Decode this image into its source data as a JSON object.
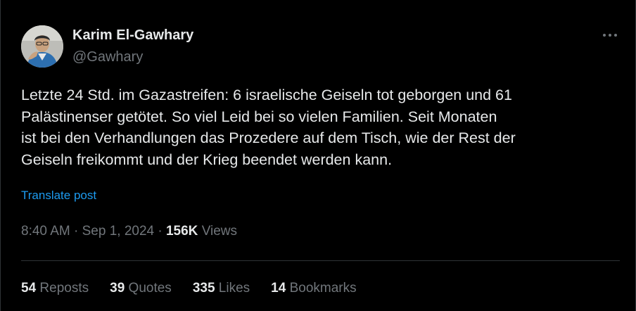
{
  "author": {
    "display_name": "Karim El-Gawhary",
    "handle": "@Gawhary"
  },
  "post": {
    "text": "Letzte 24 Std. im Gazastreifen: 6 israelische Geiseln tot geborgen und 61\nPalästinenser getötet. So viel  Leid bei so vielen Familien. Seit Monaten\nist bei den Verhandlungen das Prozedere auf dem Tisch, wie der Rest der\nGeiseln freikommt und der Krieg  beendet werden kann.",
    "translate_label": "Translate post"
  },
  "meta": {
    "time": "8:40 AM",
    "date": "Sep 1, 2024",
    "separator": "·",
    "views_count": "156K",
    "views_label": "Views"
  },
  "stats": {
    "reposts_count": "54",
    "reposts_label": "Reposts",
    "quotes_count": "39",
    "quotes_label": "Quotes",
    "likes_count": "335",
    "likes_label": "Likes",
    "bookmarks_count": "14",
    "bookmarks_label": "Bookmarks"
  },
  "icons": {
    "more": "more-horizontal-icon"
  },
  "colors": {
    "background": "#000000",
    "primary_text": "#e7e9ea",
    "secondary_text": "#71767b",
    "link": "#1d9bf0",
    "border": "#2f3336"
  }
}
